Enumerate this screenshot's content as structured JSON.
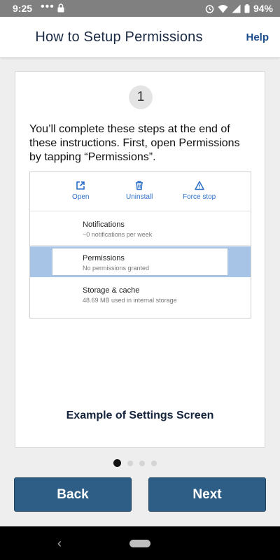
{
  "status_bar": {
    "time": "9:25",
    "notification_dots": "•••",
    "battery": "94%"
  },
  "app_bar": {
    "title": "How to Setup Permissions",
    "help_label": "Help"
  },
  "step": {
    "number": "1",
    "instructions": "You’ll complete these steps at the end of these instructions. First, open Permissions by tapping “Permissions”."
  },
  "settings_example": {
    "actions": [
      {
        "label": "Open",
        "icon": "open-external-icon"
      },
      {
        "label": "Uninstall",
        "icon": "trash-icon"
      },
      {
        "label": "Force stop",
        "icon": "warning-icon"
      }
    ],
    "rows": [
      {
        "title": "Notifications",
        "subtitle": "~0 notifications per week"
      },
      {
        "title": "Permissions",
        "subtitle": "No permissions granted"
      },
      {
        "title": "Storage & cache",
        "subtitle": "48.69 MB used in internal storage"
      }
    ],
    "highlight_color": "#a7c4e6",
    "accent_color": "#2a6fc9"
  },
  "caption": "Example of Settings Screen",
  "pager": {
    "total": 4,
    "current": 1
  },
  "buttons": {
    "back_label": "Back",
    "next_label": "Next",
    "color": "#2e5e85"
  },
  "nav_bar": {
    "back_glyph": "‹"
  }
}
